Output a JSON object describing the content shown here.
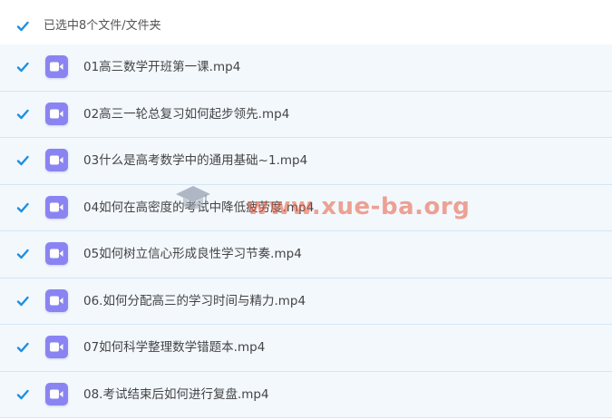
{
  "header": {
    "selection_text": "已选中8个文件/文件夹"
  },
  "files": [
    {
      "name": "01高三数学开班第一课.mp4"
    },
    {
      "name": "02高三一轮总复习如何起步领先.mp4"
    },
    {
      "name": "03什么是高考数学中的通用基础~1.mp4"
    },
    {
      "name": "04如何在高密度的考试中降低疲劳度.mp4"
    },
    {
      "name": "05如何树立信心形成良性学习节奏.mp4"
    },
    {
      "name": "06.如何分配高三的学习时间与精力.mp4"
    },
    {
      "name": "07如何科学整理数学错题本.mp4"
    },
    {
      "name": "08.考试结束后如何进行复盘.mp4"
    }
  ],
  "watermark": {
    "text": "www.xue-ba.org"
  },
  "colors": {
    "check": "#1e8fe1",
    "video_icon": "#8a84f2",
    "row_bg": "#f3f8fd"
  },
  "icons": {
    "checkbox": "check-icon",
    "file": "video-file-icon"
  }
}
